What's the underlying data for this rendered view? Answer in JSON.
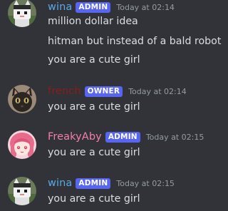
{
  "colors": {
    "background": "#313338",
    "role_badge": "#5865f2",
    "timestamp": "#949ba4",
    "message_text": "#dbdee1"
  },
  "messages": [
    {
      "author": "wina",
      "author_color": "#5aa9e6",
      "role": "ADMIN",
      "timestamp": "Today at 02:14",
      "avatar": "cat-girl-avatar",
      "lines": [
        "million dollar idea",
        "hitman but instead of a bald robot",
        "you are a cute girl"
      ]
    },
    {
      "author": "french",
      "author_color": "#8a1c1c",
      "role": "OWNER",
      "timestamp": "Today at 02:14",
      "avatar": "black-cat-avatar",
      "lines": [
        "you are a cute girl"
      ]
    },
    {
      "author": "FreakyAby",
      "author_color": "#f47fa8",
      "role": "ADMIN",
      "timestamp": "Today at 02:15",
      "avatar": "pink-hair-girl-avatar",
      "lines": [
        "you are a cute girl"
      ]
    },
    {
      "author": "wina",
      "author_color": "#5aa9e6",
      "role": "ADMIN",
      "timestamp": "Today at 02:15",
      "avatar": "cat-girl-avatar",
      "lines": [
        "you are a cute girl"
      ]
    }
  ]
}
